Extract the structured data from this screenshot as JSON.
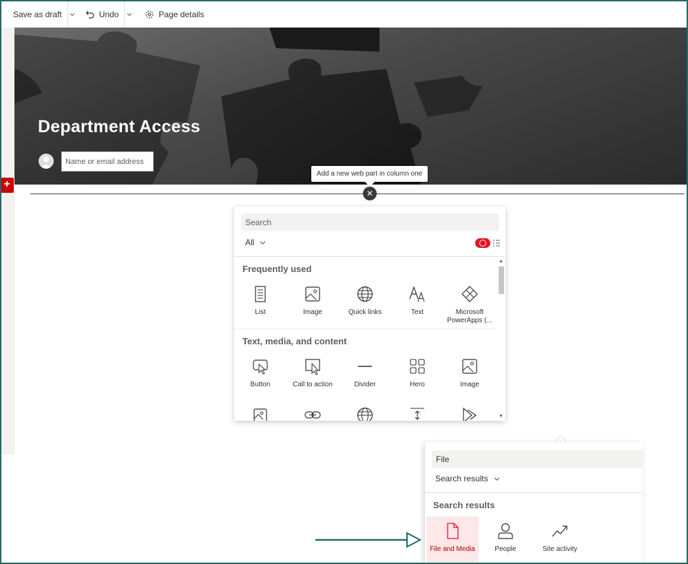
{
  "command_bar": {
    "save_label": "Save as draft",
    "undo_label": "Undo",
    "page_details_label": "Page details"
  },
  "hero": {
    "title": "Department Access",
    "author_placeholder": "Name or email address"
  },
  "add_section_label": "+",
  "tooltip": "Add a new web part in column one",
  "close_label": "✕",
  "toolbox": {
    "search_placeholder": "Search",
    "filter_value": "All",
    "groups": [
      {
        "heading": "Frequently used",
        "items": [
          {
            "label": "List",
            "icon": "list-icon"
          },
          {
            "label": "Image",
            "icon": "image-icon"
          },
          {
            "label": "Quick links",
            "icon": "globe-icon"
          },
          {
            "label": "Text",
            "icon": "text-icon"
          },
          {
            "label": "Microsoft PowerApps (...",
            "icon": "powerapps-icon"
          }
        ]
      },
      {
        "heading": "Text, media, and content",
        "items": [
          {
            "label": "Button",
            "icon": "button-icon"
          },
          {
            "label": "Call to action",
            "icon": "call-to-action-icon"
          },
          {
            "label": "Divider",
            "icon": "divider-icon"
          },
          {
            "label": "Hero",
            "icon": "hero-icon"
          },
          {
            "label": "Image",
            "icon": "image-icon"
          }
        ]
      }
    ],
    "partial_row_icons": [
      "image-gallery-icon",
      "link-icon",
      "globe-icon",
      "spacer-icon",
      "stream-icon"
    ]
  },
  "search_panel": {
    "search_value": "File",
    "filter_value": "Search results",
    "heading": "Search results",
    "items": [
      {
        "label": "File and Media",
        "icon": "file-icon",
        "selected": true
      },
      {
        "label": "People",
        "icon": "person-icon",
        "selected": false
      },
      {
        "label": "Site activity",
        "icon": "trend-icon",
        "selected": false
      }
    ]
  },
  "colors": {
    "accent_red": "#e81123",
    "selected_bg": "#fde7e9",
    "frame": "#1e6b66",
    "arrow": "#1e6b66"
  }
}
